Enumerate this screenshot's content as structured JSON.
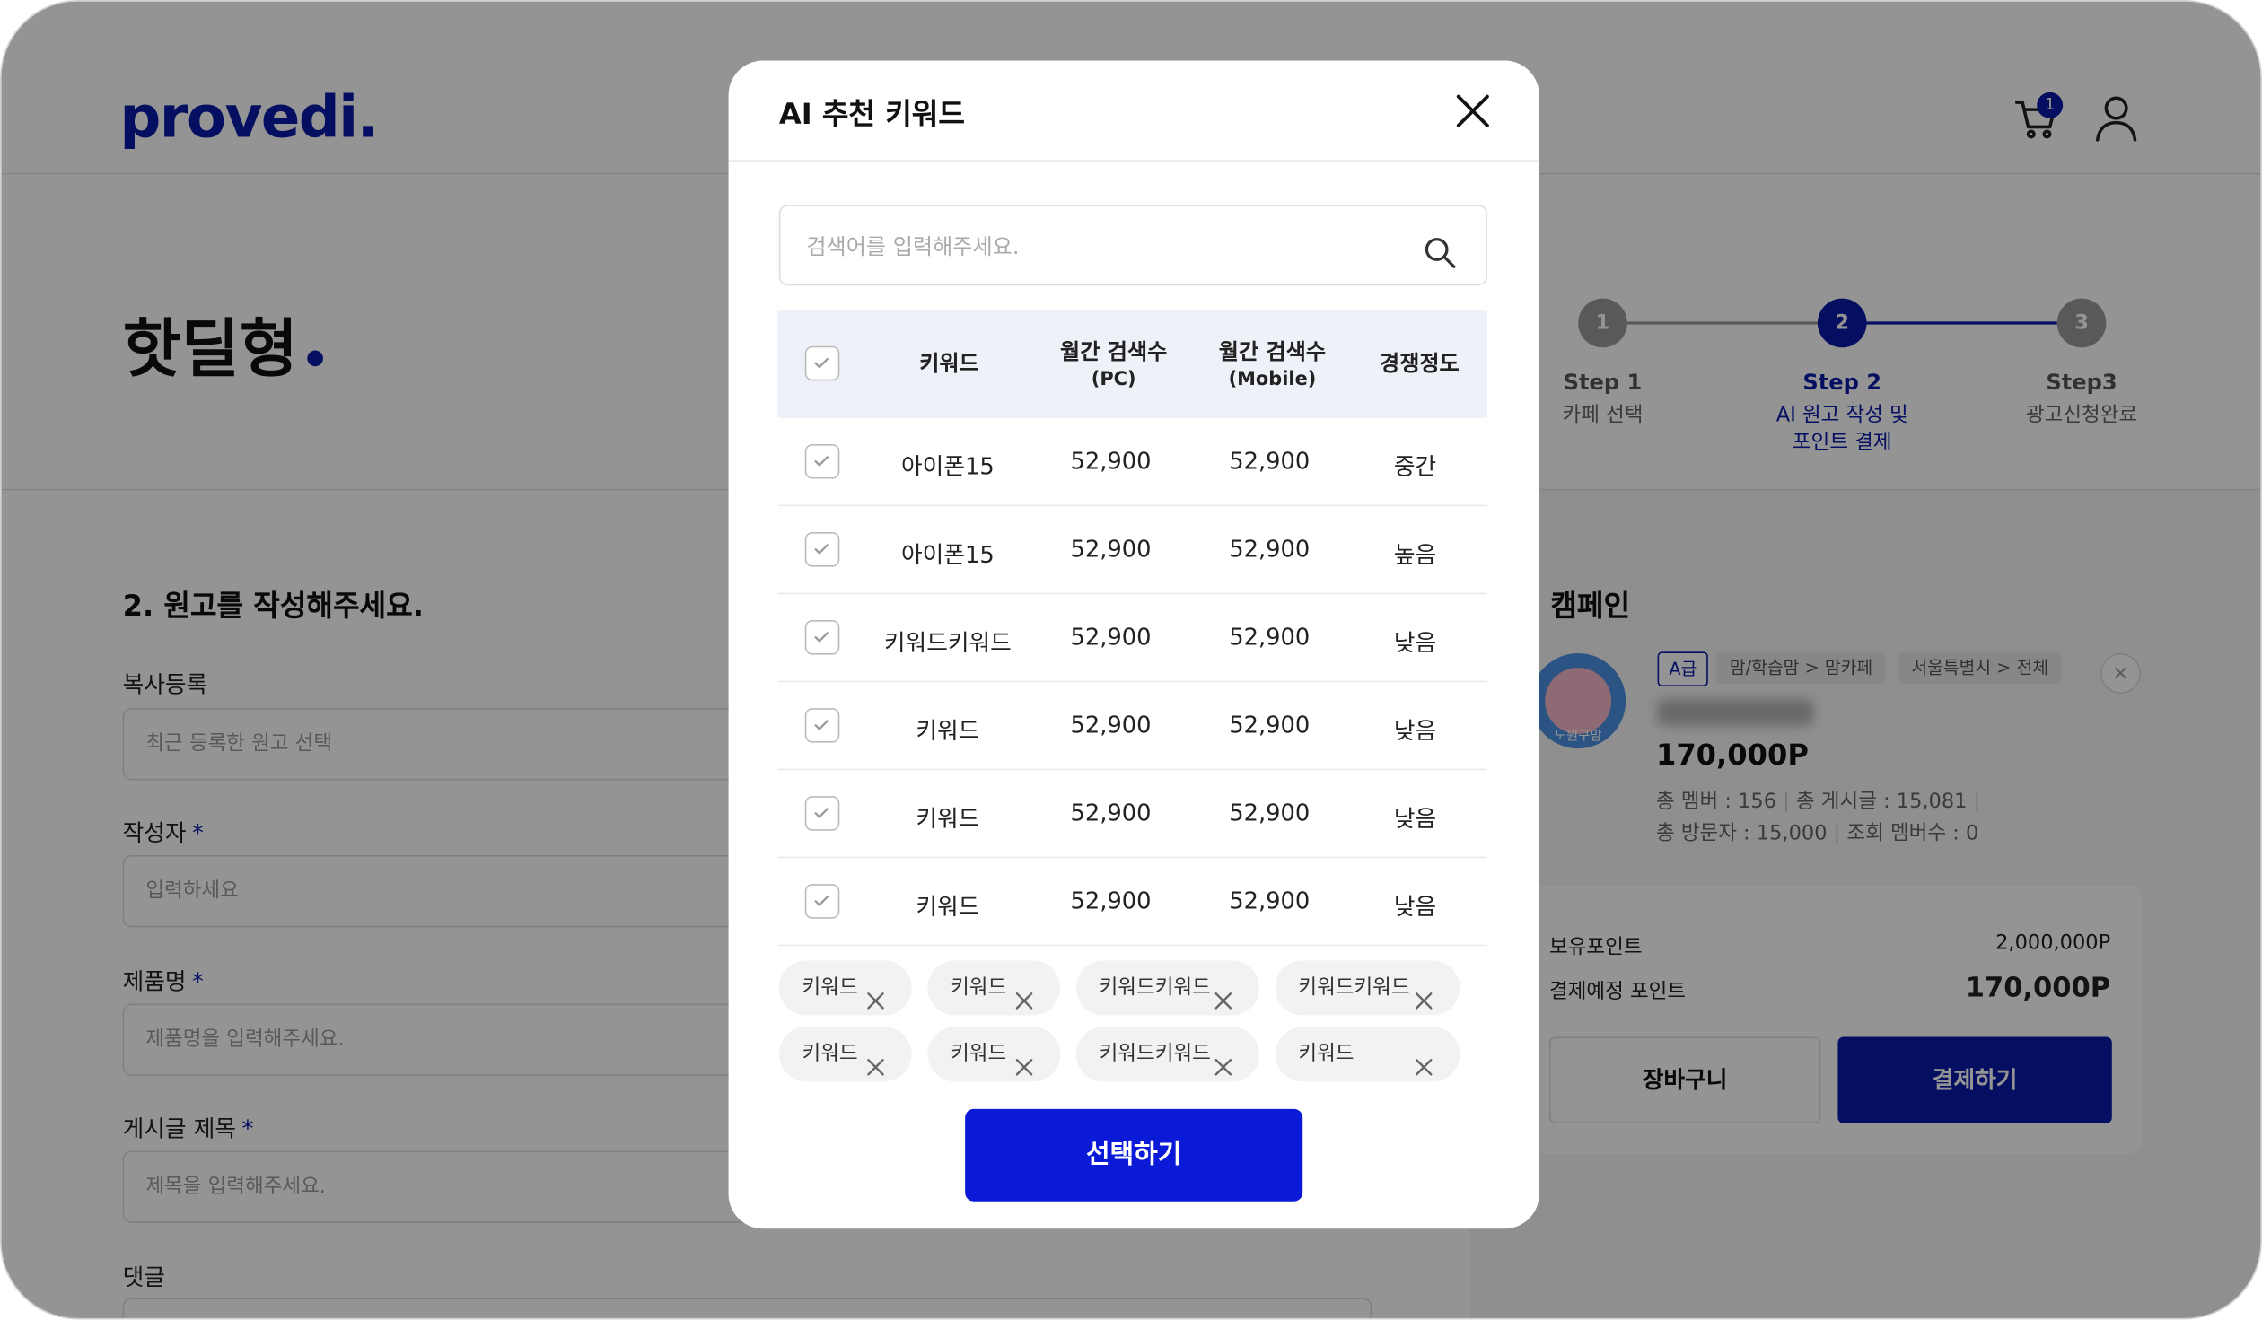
{
  "header": {
    "logo": "provedi.",
    "cart_count": "1"
  },
  "page": {
    "title": "핫딜형"
  },
  "stepper": {
    "steps": [
      {
        "num": "1",
        "label": "Step 1",
        "sub1": "카페 선택",
        "sub2": ""
      },
      {
        "num": "2",
        "label": "Step 2",
        "sub1": "AI 원고 작성 및",
        "sub2": "포인트 결제"
      },
      {
        "num": "3",
        "label": "Step3",
        "sub1": "광고신청완료",
        "sub2": ""
      }
    ]
  },
  "form": {
    "section_title": "2. 원고를 작성해주세요.",
    "fields": [
      {
        "label": "복사등록",
        "required": false,
        "placeholder": "최근 등록한 원고 선택"
      },
      {
        "label": "작성자",
        "required": true,
        "placeholder": "입력하세요"
      },
      {
        "label": "제품명",
        "required": true,
        "placeholder": "제품명을 입력해주세요."
      },
      {
        "label": "게시글 제목",
        "required": true,
        "placeholder": "제목을 입력해주세요."
      },
      {
        "label": "댓글",
        "required": false,
        "placeholder": ""
      }
    ],
    "required_mark": "*"
  },
  "campaign": {
    "title": "l 캠페인",
    "avatar_label": "노원구맘",
    "grade": "A급",
    "category1": "맘/학습맘",
    "category2": "맘카페",
    "region1": "서울특별시",
    "region2": "전체",
    "arrow": ">",
    "close": "×",
    "price": "170,000P",
    "meta1": "총 멤버 : 156",
    "meta2": "총 게시글 : 15,081",
    "meta3": "총 방문자 : 15,000",
    "meta4": "조회 멤버수 : 0",
    "divider": "|",
    "owned_points_label": "보유포인트",
    "owned_points_value": "2,000,000P",
    "expected_points_label": "결제예정 포인트",
    "expected_points_value": "170,000P",
    "cart_button": "장바구니",
    "pay_button": "결제하기"
  },
  "modal": {
    "title": "AI 추천 키워드",
    "search_placeholder": "검색어를 입력해주세요.",
    "columns": {
      "keyword": "키워드",
      "pc_1": "월간 검색수",
      "pc_2": "(PC)",
      "mobile_1": "월간 검색수",
      "mobile_2": "(Mobile)",
      "competition": "경쟁정도"
    },
    "rows": [
      {
        "keyword": "아이폰15",
        "pc": "52,900",
        "mobile": "52,900",
        "competition": "중간",
        "checked": true
      },
      {
        "keyword": "아이폰15",
        "pc": "52,900",
        "mobile": "52,900",
        "competition": "높음",
        "checked": true
      },
      {
        "keyword": "키워드키워드",
        "pc": "52,900",
        "mobile": "52,900",
        "competition": "낮음",
        "checked": true
      },
      {
        "keyword": "키워드",
        "pc": "52,900",
        "mobile": "52,900",
        "competition": "낮음",
        "checked": true
      },
      {
        "keyword": "키워드",
        "pc": "52,900",
        "mobile": "52,900",
        "competition": "낮음",
        "checked": true
      },
      {
        "keyword": "키워드",
        "pc": "52,900",
        "mobile": "52,900",
        "competition": "낮음",
        "checked": true
      }
    ],
    "chips": [
      "키워드",
      "키워드",
      "키워드키워드",
      "키워드키워드",
      "키워드",
      "키워드",
      "키워드키워드",
      "키워드"
    ],
    "select_button": "선택하기"
  },
  "colors": {
    "brand": "#0a1aa8",
    "button_primary": "#0a1ad6",
    "step_inactive": "#999999"
  }
}
